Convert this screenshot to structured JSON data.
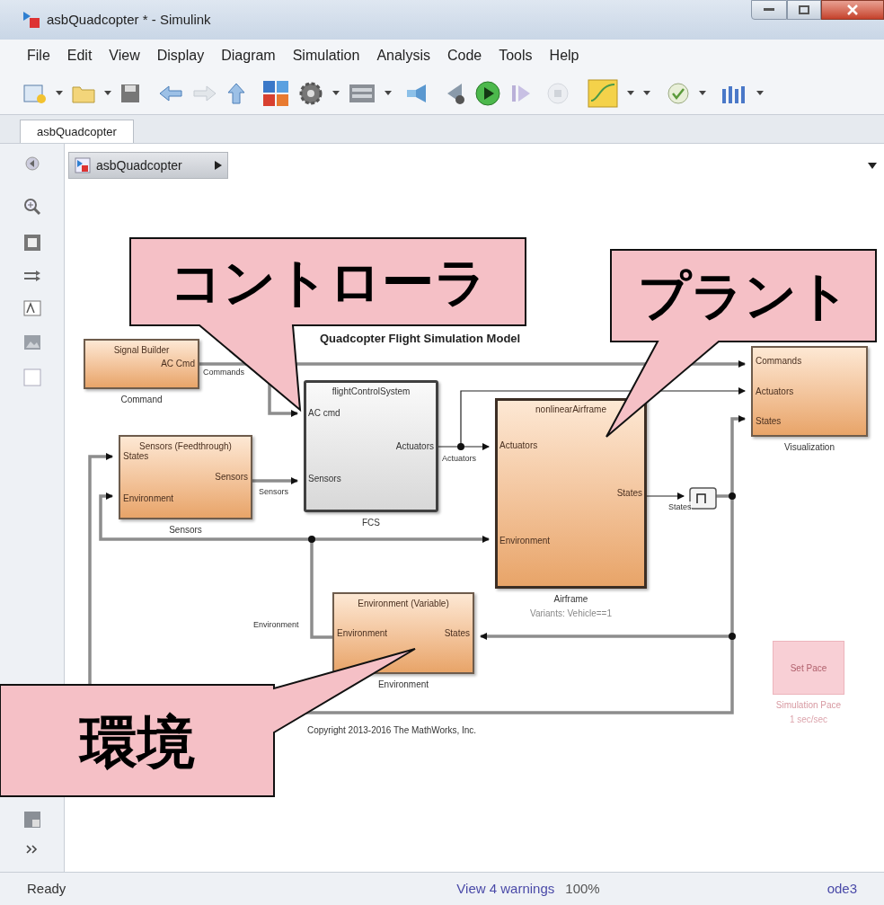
{
  "window": {
    "title": "asbQuadcopter * - Simulink"
  },
  "menu": [
    "File",
    "Edit",
    "View",
    "Display",
    "Diagram",
    "Simulation",
    "Analysis",
    "Code",
    "Tools",
    "Help"
  ],
  "tabs": [
    {
      "label": "asbQuadcopter",
      "selected": true
    }
  ],
  "breadcrumb": {
    "label": "asbQuadcopter"
  },
  "diagram": {
    "title": "Quadcopter Flight Simulation Model",
    "copyright": "Copyright 2013-2016 The MathWorks, Inc.",
    "blocks": [
      {
        "kind": "subsystem",
        "title": "Signal Builder",
        "right_ports": [
          "AC Cmd"
        ],
        "label": "Command"
      },
      {
        "kind": "subsystem",
        "title": "Sensors (Feedthrough)",
        "left_ports": [
          "States",
          "Environment"
        ],
        "right_ports": [
          "Sensors"
        ],
        "label": "Sensors"
      },
      {
        "kind": "reference",
        "title": "flightControlSystem",
        "left_ports": [
          "AC cmd",
          "Sensors"
        ],
        "right_ports": [
          "Actuators"
        ],
        "label": "FCS"
      },
      {
        "kind": "variant",
        "title": "nonlinearAirframe",
        "left_ports": [
          "Actuators",
          "Environment"
        ],
        "right_ports": [
          "States"
        ],
        "label": "Airframe",
        "sublabel": "Variants: Vehicle==1"
      },
      {
        "kind": "subsystem",
        "left_ports": [
          "Commands",
          "Actuators",
          "States"
        ],
        "label": "Visualization"
      },
      {
        "kind": "subsystem",
        "title": "Environment (Variable)",
        "left_ports": [
          "Environment"
        ],
        "right_ports": [
          "States"
        ],
        "label": "Environment"
      },
      {
        "kind": "pace",
        "title": "Set Pace",
        "label": "Simulation Pace",
        "sublabel": "1 sec/sec"
      }
    ],
    "line_labels": [
      "Commands",
      "Sensors",
      "Actuators",
      "States",
      "Environment"
    ],
    "callouts": [
      {
        "text": "コントローラ"
      },
      {
        "text": "プラント"
      },
      {
        "text": "環境"
      }
    ]
  },
  "status_bar": {
    "state": "Ready",
    "warnings": "View 4 warnings",
    "zoom": "100%",
    "solver": "ode3"
  }
}
